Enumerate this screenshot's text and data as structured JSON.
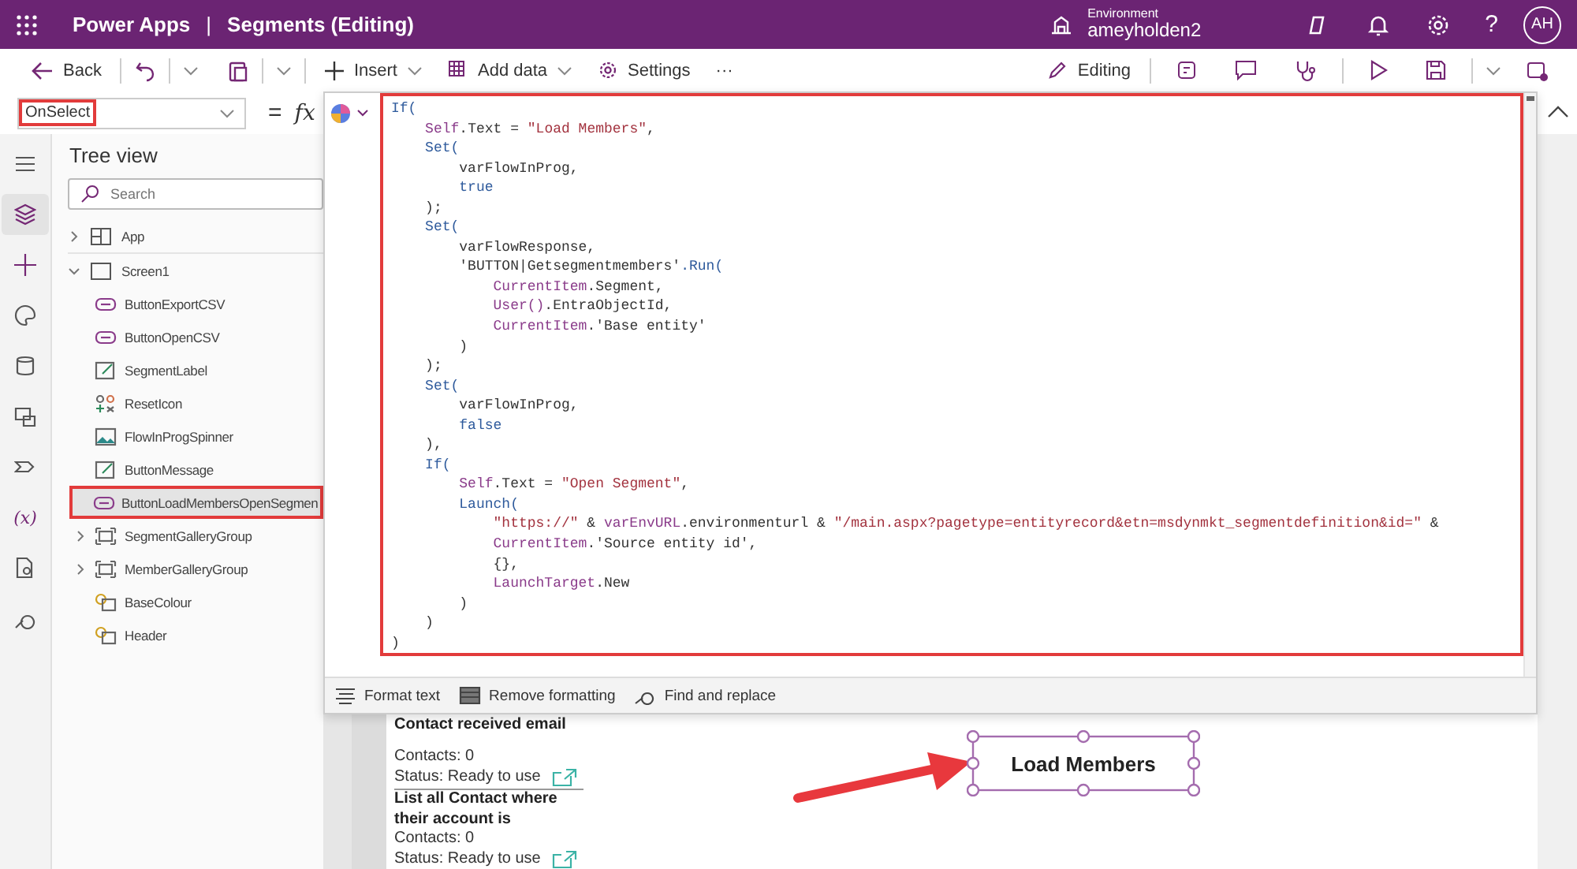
{
  "header": {
    "app_name": "Power Apps",
    "separator": "|",
    "title": "Segments (Editing)",
    "environment_label": "Environment",
    "environment_name": "ameyholden2",
    "help": "?",
    "avatar": "AH"
  },
  "toolbar": {
    "back": "Back",
    "insert": "Insert",
    "add_data": "Add data",
    "settings": "Settings",
    "more": "···",
    "mode": "Editing"
  },
  "formula_bar": {
    "property": "OnSelect",
    "equals": "=",
    "fx": "fx"
  },
  "rail": [
    {
      "kind": "menu",
      "selected": false
    },
    {
      "kind": "tree",
      "selected": true
    },
    {
      "kind": "insert",
      "selected": false
    },
    {
      "kind": "theme",
      "selected": false
    },
    {
      "kind": "data",
      "selected": false
    },
    {
      "kind": "media",
      "selected": false
    },
    {
      "kind": "flows",
      "selected": false
    },
    {
      "kind": "variables",
      "label": "(x)",
      "selected": false
    },
    {
      "kind": "doc",
      "selected": false
    },
    {
      "kind": "search",
      "selected": false
    }
  ],
  "tree_view": {
    "title": "Tree view",
    "search": {
      "placeholder": "Search"
    },
    "items": [
      {
        "label": "App",
        "kind": "app",
        "expanded": false,
        "selected": false
      },
      {
        "label": "Screen1",
        "kind": "screen",
        "expanded": true,
        "selected": false,
        "children": [
          {
            "label": "ButtonExportCSV",
            "kind": "button",
            "selected": false
          },
          {
            "label": "ButtonOpenCSV",
            "kind": "button",
            "selected": false
          },
          {
            "label": "SegmentLabel",
            "kind": "label",
            "selected": false
          },
          {
            "label": "ResetIcon",
            "kind": "icon",
            "selected": false
          },
          {
            "label": "FlowInProgSpinner",
            "kind": "image",
            "selected": false
          },
          {
            "label": "ButtonMessage",
            "kind": "label",
            "selected": false
          },
          {
            "label": "ButtonLoadMembersOpenSegmen",
            "kind": "button",
            "selected": true
          },
          {
            "label": "SegmentGalleryGroup",
            "kind": "group",
            "expanded": false,
            "selected": false
          },
          {
            "label": "MemberGalleryGroup",
            "kind": "group",
            "expanded": false,
            "selected": false
          },
          {
            "label": "BaseColour",
            "kind": "shape",
            "selected": false
          },
          {
            "label": "Header",
            "kind": "shape",
            "selected": false
          }
        ]
      }
    ]
  },
  "code_editor": {
    "lines": [
      [
        {
          "text": "If(",
          "kind": "keyword"
        }
      ],
      [
        {
          "text": "    Self",
          "kind": "name"
        },
        {
          "text": ".Text = ",
          "kind": "plain"
        },
        {
          "text": "\"Load Members\"",
          "kind": "string"
        },
        {
          "text": ",",
          "kind": "plain"
        }
      ],
      [
        {
          "text": "    Set(",
          "kind": "keyword"
        }
      ],
      [
        {
          "text": "        varFlowInProg,",
          "kind": "plain"
        }
      ],
      [
        {
          "text": "        true",
          "kind": "keyword"
        }
      ],
      [
        {
          "text": "    );",
          "kind": "plain"
        }
      ],
      [
        {
          "text": "    Set(",
          "kind": "keyword"
        }
      ],
      [
        {
          "text": "        varFlowResponse,",
          "kind": "plain"
        }
      ],
      [
        {
          "text": "        'BUTTON|Getsegmentmembers'",
          "kind": "plain"
        },
        {
          "text": ".Run(",
          "kind": "keyword"
        }
      ],
      [
        {
          "text": "            CurrentItem",
          "kind": "name"
        },
        {
          "text": ".Segment,",
          "kind": "plain"
        }
      ],
      [
        {
          "text": "            User()",
          "kind": "name"
        },
        {
          "text": ".EntraObjectId,",
          "kind": "plain"
        }
      ],
      [
        {
          "text": "            CurrentItem",
          "kind": "name"
        },
        {
          "text": ".'Base entity'",
          "kind": "plain"
        }
      ],
      [
        {
          "text": "        )",
          "kind": "plain"
        }
      ],
      [
        {
          "text": "    );",
          "kind": "plain"
        }
      ],
      [
        {
          "text": "    Set(",
          "kind": "keyword"
        }
      ],
      [
        {
          "text": "        varFlowInProg,",
          "kind": "plain"
        }
      ],
      [
        {
          "text": "        false",
          "kind": "keyword"
        }
      ],
      [
        {
          "text": "    ),",
          "kind": "plain"
        }
      ],
      [
        {
          "text": "    If(",
          "kind": "keyword"
        }
      ],
      [
        {
          "text": "        Self",
          "kind": "name"
        },
        {
          "text": ".Text = ",
          "kind": "plain"
        },
        {
          "text": "\"Open Segment\"",
          "kind": "string"
        },
        {
          "text": ",",
          "kind": "plain"
        }
      ],
      [
        {
          "text": "        Launch(",
          "kind": "keyword"
        }
      ],
      [
        {
          "text": "            \"https://\"",
          "kind": "string"
        },
        {
          "text": " & ",
          "kind": "plain"
        },
        {
          "text": "varEnvURL",
          "kind": "name"
        },
        {
          "text": ".environmenturl & ",
          "kind": "plain"
        },
        {
          "text": "\"/main.aspx?pagetype=entityrecord&etn=msdynmkt_segmentdefinition&id=\"",
          "kind": "string"
        },
        {
          "text": " &",
          "kind": "plain"
        }
      ],
      [
        {
          "text": "            CurrentItem",
          "kind": "name"
        },
        {
          "text": ".'Source entity id',",
          "kind": "plain"
        }
      ],
      [
        {
          "text": "            {},",
          "kind": "plain"
        }
      ],
      [
        {
          "text": "            LaunchTarget",
          "kind": "name"
        },
        {
          "text": ".New",
          "kind": "plain"
        }
      ],
      [
        {
          "text": "        )",
          "kind": "plain"
        }
      ],
      [
        {
          "text": "    )",
          "kind": "plain"
        }
      ],
      [
        {
          "text": ")",
          "kind": "plain"
        }
      ]
    ]
  },
  "format_bar": [
    {
      "kind": "format",
      "label": "Format text"
    },
    {
      "kind": "remove",
      "label": "Remove formatting"
    },
    {
      "kind": "find",
      "label": "Find and replace"
    }
  ],
  "canvas": {
    "gallery": [
      {
        "title": "Contact received email",
        "contacts": "Contacts: 0",
        "status": "Status: Ready to use"
      },
      {
        "title": "List all Contact where their account is",
        "contacts": "Contacts: 0",
        "status": "Status: Ready to use"
      }
    ],
    "button": {
      "label": "Load Members",
      "selected": true
    }
  }
}
